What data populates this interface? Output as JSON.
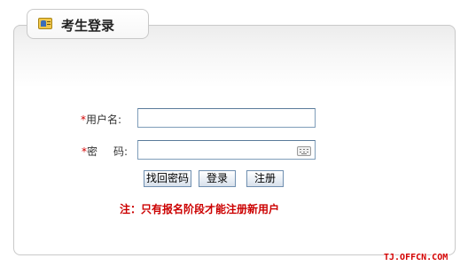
{
  "header": {
    "title": "考生登录",
    "icon": "id-card-icon"
  },
  "form": {
    "username": {
      "required_mark": "*",
      "label": "用户名:",
      "value": "",
      "placeholder": ""
    },
    "password": {
      "required_mark": "*",
      "label_part1": "密",
      "label_part2": "码:",
      "value": "",
      "placeholder": "",
      "keyboard_icon": "soft-keyboard-icon"
    }
  },
  "buttons": {
    "find_password": "找回密码",
    "login": "登录",
    "register": "注册"
  },
  "notice": "注：只有报名阶段才能注册新用户",
  "watermark": "TJ.OFFCN.COM",
  "colors": {
    "required": "#d40000",
    "notice": "#cc0000",
    "border": "#c9c9c9",
    "input_border": "#7f9db9"
  }
}
